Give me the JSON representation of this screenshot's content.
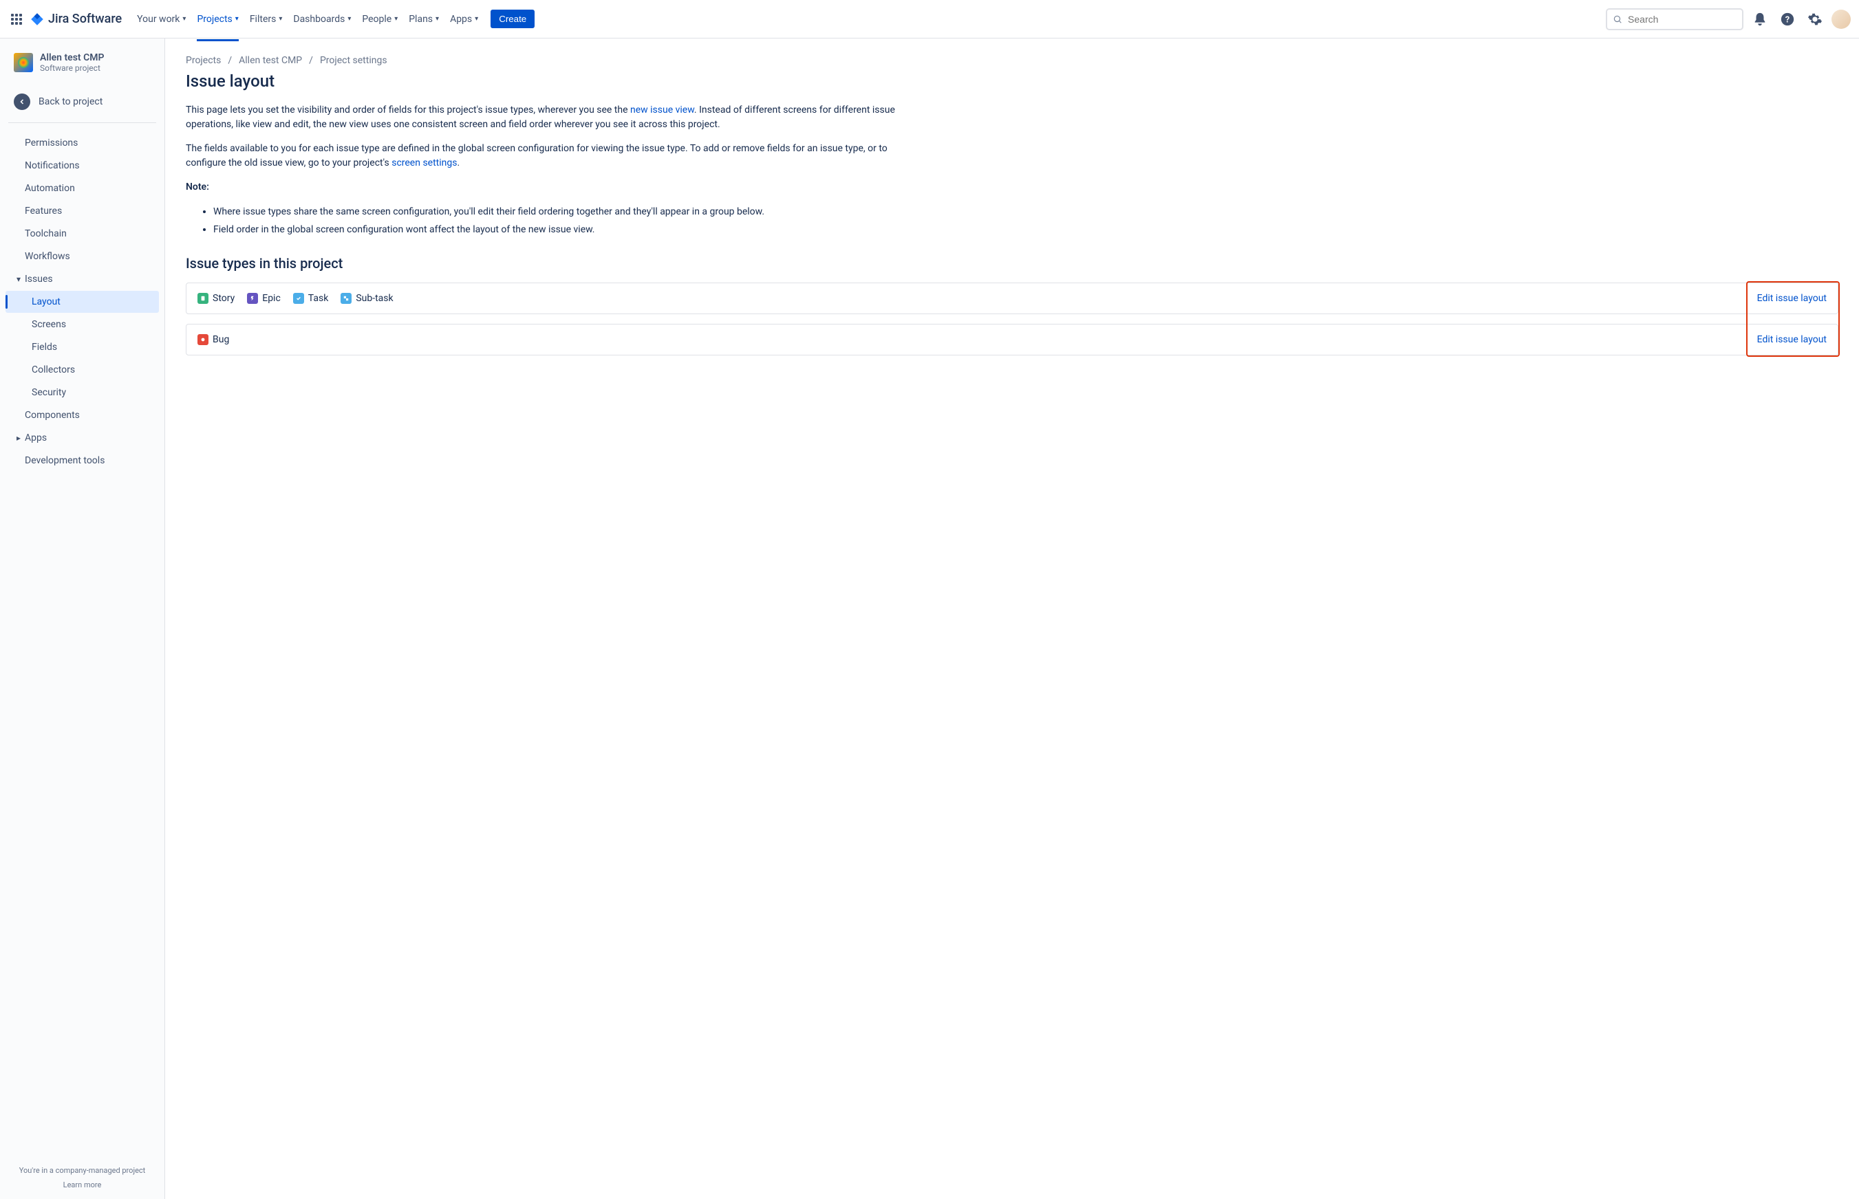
{
  "topnav": {
    "logo_text": "Jira Software",
    "items": [
      {
        "label": "Your work"
      },
      {
        "label": "Projects",
        "active": true
      },
      {
        "label": "Filters"
      },
      {
        "label": "Dashboards"
      },
      {
        "label": "People"
      },
      {
        "label": "Plans"
      },
      {
        "label": "Apps"
      }
    ],
    "create": "Create",
    "search_placeholder": "Search"
  },
  "sidebar": {
    "project_name": "Allen test CMP",
    "project_type": "Software project",
    "back_label": "Back to project",
    "items": [
      {
        "label": "Permissions"
      },
      {
        "label": "Notifications"
      },
      {
        "label": "Automation"
      },
      {
        "label": "Features"
      },
      {
        "label": "Toolchain"
      },
      {
        "label": "Workflows"
      },
      {
        "label": "Issues",
        "chev": "down"
      },
      {
        "label": "Layout",
        "sub": true,
        "selected": true
      },
      {
        "label": "Screens",
        "sub": true
      },
      {
        "label": "Fields",
        "sub": true
      },
      {
        "label": "Collectors",
        "sub": true
      },
      {
        "label": "Security",
        "sub": true
      },
      {
        "label": "Components"
      },
      {
        "label": "Apps",
        "chev": "right"
      },
      {
        "label": "Development tools"
      }
    ],
    "footer_text": "You're in a company-managed project",
    "footer_learn": "Learn more"
  },
  "breadcrumb": [
    "Projects",
    "Allen test CMP",
    "Project settings"
  ],
  "page_title": "Issue layout",
  "desc1_a": "This page lets you set the visibility and order of fields for this project's issue types, wherever you see the ",
  "desc1_link": "new issue view",
  "desc1_b": ". Instead of different screens for different issue operations, like view and edit, the new view uses one consistent screen and field order wherever you see it across this project.",
  "desc2_a": "The fields available to you for each issue type are defined in the global screen configuration for viewing the issue type. To add or remove fields for an issue type, or to configure the old issue view, go to your project's ",
  "desc2_link": "screen settings",
  "desc2_b": ".",
  "note_label": "Note:",
  "notes": [
    "Where issue types share the same screen configuration, you'll edit their field ordering together and they'll appear in a group below.",
    "Field order in the global screen configuration wont affect the layout of the new issue view."
  ],
  "section_title": "Issue types in this project",
  "rows": [
    {
      "types": [
        {
          "name": "Story",
          "kind": "story"
        },
        {
          "name": "Epic",
          "kind": "epic"
        },
        {
          "name": "Task",
          "kind": "task"
        },
        {
          "name": "Sub-task",
          "kind": "subtask"
        }
      ],
      "action": "Edit issue layout"
    },
    {
      "types": [
        {
          "name": "Bug",
          "kind": "bug"
        }
      ],
      "action": "Edit issue layout"
    }
  ]
}
